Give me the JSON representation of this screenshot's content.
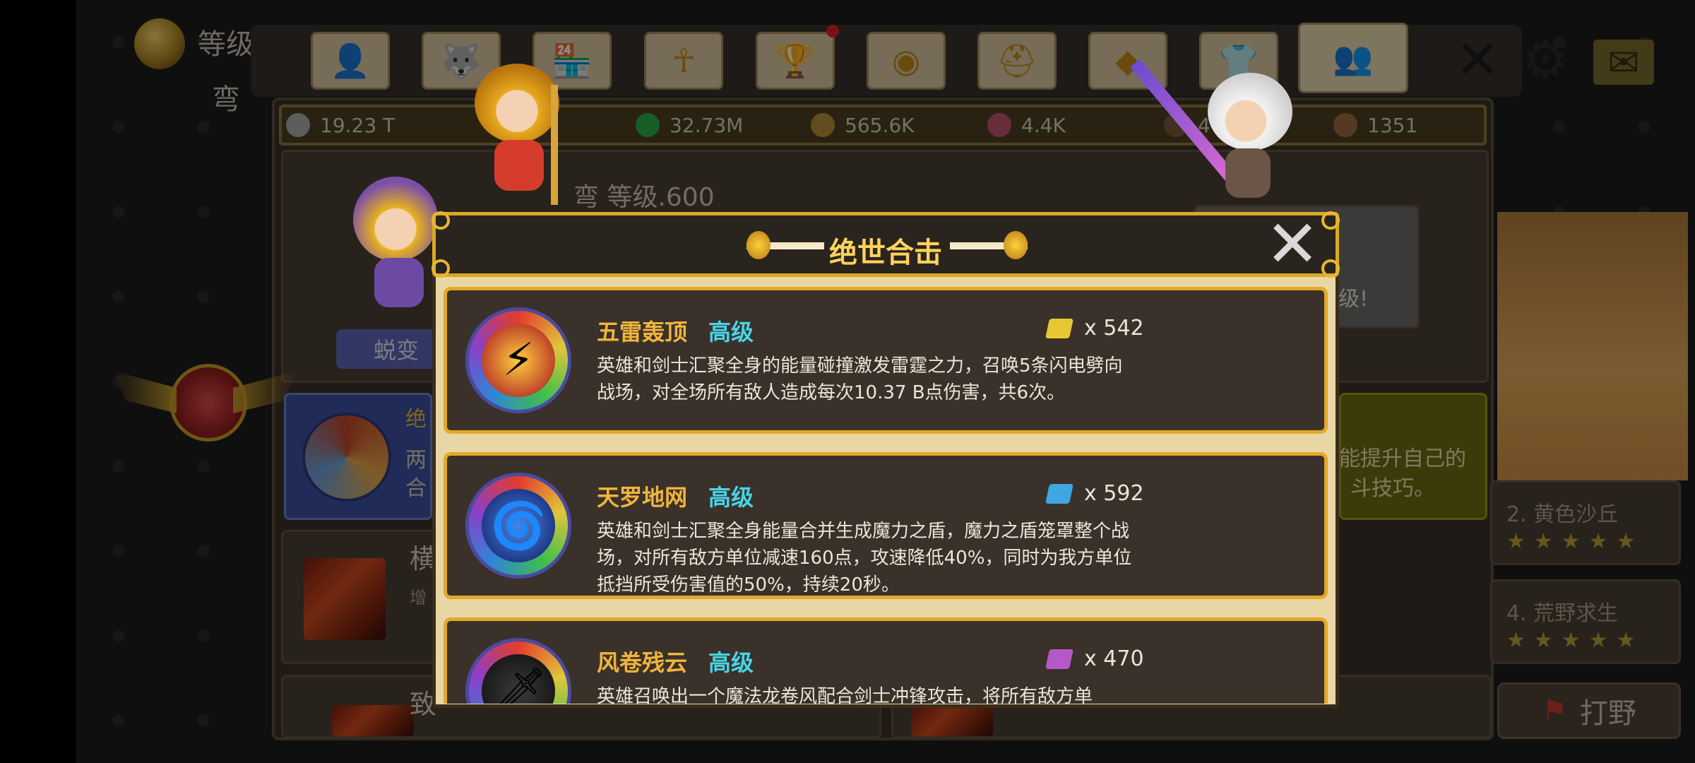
{
  "player": {
    "level_label": "等级",
    "name": "弯"
  },
  "tabs": [
    {
      "icon": "person-icon",
      "glyph": "👤"
    },
    {
      "icon": "wolf-icon",
      "glyph": "🐺"
    },
    {
      "icon": "shop-icon",
      "glyph": "🏪"
    },
    {
      "icon": "ankh-icon",
      "glyph": "☥"
    },
    {
      "icon": "trophy-icon",
      "glyph": "🏆"
    },
    {
      "icon": "orb-icon",
      "glyph": "◉"
    },
    {
      "icon": "helmet-icon",
      "glyph": "⛑"
    },
    {
      "icon": "gem-icon",
      "glyph": "◆"
    },
    {
      "icon": "shirt-icon",
      "glyph": "👕"
    },
    {
      "icon": "partners-icon",
      "glyph": "👥"
    }
  ],
  "header_icons": {
    "close": "✕",
    "settings": "⚙",
    "mail": "✉"
  },
  "currencies": [
    {
      "icon": "silver-coin-icon",
      "value": "19.23 T",
      "color": "#a9a9a9"
    },
    {
      "icon": "green-orb-icon",
      "value": "32.73M",
      "color": "#2ea84a"
    },
    {
      "icon": "wing-token-icon",
      "value": "565.6K",
      "color": "#b58a3a"
    },
    {
      "icon": "beast-token-icon",
      "value": "4.4K",
      "color": "#c0506a"
    },
    {
      "icon": "shard-icon",
      "value": "4",
      "color": "#7a5a3a"
    },
    {
      "icon": "copper-coin-icon",
      "value": "1351",
      "color": "#9a6b3f"
    }
  ],
  "page": {
    "level_title": "弯 等级.600",
    "evolve_button": "蜕变",
    "blue_card_title": "绝",
    "blue_card_text_1": "两",
    "blue_card_text_2": "合",
    "yellow_card_text_1": "能提升自己的",
    "yellow_card_text_2": "斗技巧。",
    "grey_card_text": "级!",
    "row1_title": "横",
    "row1_sub": "增",
    "row2_title": "致",
    "right_items": [
      {
        "title": "2. 黄色沙丘",
        "stars": "★★★★★"
      },
      {
        "title": "4. 荒野求生",
        "stars": "★★★★★"
      }
    ],
    "hunt_button": "打野"
  },
  "modal": {
    "title": "绝世合击",
    "close": "✕",
    "skills": [
      {
        "name": "五雷轰顶",
        "grade": "高级",
        "icon": "thunder-sword-icon",
        "glyph": "⚡",
        "scroll_color": "#e8c832",
        "qty": "x 542",
        "desc": "英雄和剑士汇聚全身的能量碰撞激发雷霆之力，召唤5条闪电劈向战场，对全场所有敌人造成每次10.37 B点伤害，共6次。"
      },
      {
        "name": "天罗地网",
        "grade": "高级",
        "icon": "shield-vortex-icon",
        "glyph": "🌀",
        "scroll_color": "#3ea6e0",
        "qty": "x 592",
        "desc": "英雄和剑士汇聚全身能量合并生成魔力之盾，魔力之盾笼罩整个战场，对所有敌方单位减速160点，攻速降低40%，同时为我方单位抵挡所受伤害值的50%，持续20秒。"
      },
      {
        "name": "风卷残云",
        "grade": "高级",
        "icon": "tornado-sword-icon",
        "glyph": "🗡",
        "scroll_color": "#b45ac8",
        "qty": "x 470",
        "desc": "英雄召唤出一个魔法龙卷风配合剑士冲锋攻击，将所有敌方单"
      }
    ]
  }
}
